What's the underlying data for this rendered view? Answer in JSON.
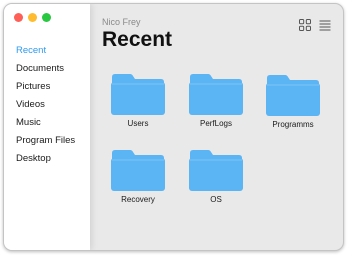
{
  "window": {
    "traffic_lights": [
      "#fe5f57",
      "#febc2e",
      "#28c840"
    ]
  },
  "sidebar": {
    "accent_color": "#2f9af1",
    "items": [
      {
        "label": "Recent",
        "active": true
      },
      {
        "label": "Documents",
        "active": false
      },
      {
        "label": "Pictures",
        "active": false
      },
      {
        "label": "Videos",
        "active": false
      },
      {
        "label": "Music",
        "active": false
      },
      {
        "label": "Program Files",
        "active": false
      },
      {
        "label": "Desktop",
        "active": false
      }
    ]
  },
  "header": {
    "user": "Nico Frey",
    "title": "Recent",
    "view_icons": [
      "grid-view-icon",
      "list-view-icon"
    ]
  },
  "folders": {
    "color": "#5bb4f3",
    "items": [
      {
        "label": "Users"
      },
      {
        "label": "PerfLogs"
      },
      {
        "label": "Programms"
      },
      {
        "label": "Recovery"
      },
      {
        "label": "OS"
      }
    ]
  }
}
